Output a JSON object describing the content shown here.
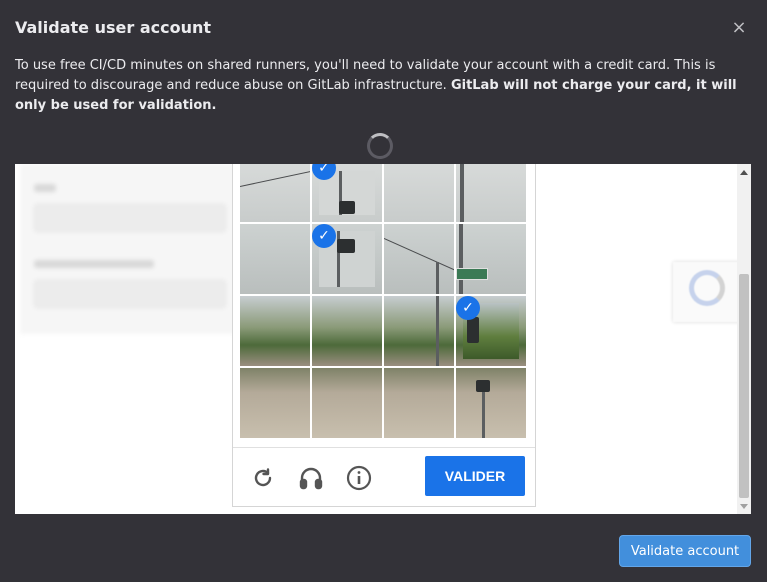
{
  "modal": {
    "title": "Validate user account",
    "close_label": "×",
    "description_plain": "To use free CI/CD minutes on shared runners, you'll need to validate your account with a credit card. This is required to discourage and reduce abuse on GitLab infrastructure. ",
    "description_bold": "GitLab will not charge your card, it will only be used for validation."
  },
  "captcha": {
    "selected_tiles": [
      1,
      5,
      11
    ],
    "check_mark": "✓",
    "verify_label": "VALIDER",
    "icons": [
      "reload-icon",
      "headphones-icon",
      "info-icon"
    ]
  },
  "footer": {
    "validate_label": "Validate account"
  },
  "colors": {
    "modal_bg": "#333238",
    "captcha_blue": "#1a73e8",
    "primary_button": "#428fdc"
  }
}
